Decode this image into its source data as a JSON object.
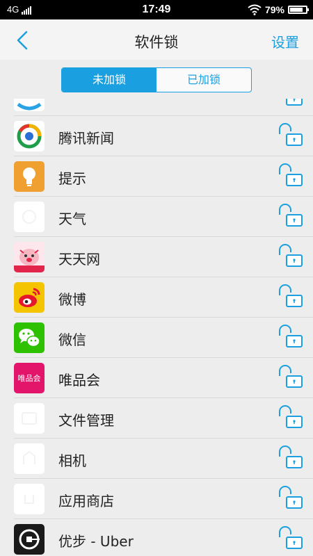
{
  "status": {
    "network": "4G",
    "time": "17:49",
    "battery": "79%"
  },
  "header": {
    "title": "软件锁",
    "settings_label": "设置"
  },
  "tabs": [
    {
      "label": "未加锁",
      "active": true
    },
    {
      "label": "已加锁",
      "active": false
    }
  ],
  "apps": [
    {
      "name": "",
      "icon": "partial-app-icon"
    },
    {
      "name": "腾讯新闻",
      "icon": "tencent-news-icon"
    },
    {
      "name": "提示",
      "icon": "tips-icon"
    },
    {
      "name": "天气",
      "icon": "weather-icon"
    },
    {
      "name": "天天网",
      "icon": "tiantian-icon"
    },
    {
      "name": "微博",
      "icon": "weibo-icon"
    },
    {
      "name": "微信",
      "icon": "wechat-icon"
    },
    {
      "name": "唯品会",
      "icon": "vipshop-icon",
      "icon_text": "唯品会"
    },
    {
      "name": "文件管理",
      "icon": "file-manager-icon"
    },
    {
      "name": "相机",
      "icon": "camera-icon"
    },
    {
      "name": "应用商店",
      "icon": "app-store-icon"
    },
    {
      "name": "优步 - Uber",
      "icon": "uber-icon"
    }
  ],
  "colors": {
    "accent": "#1aa0e0",
    "background": "#ededed",
    "weibo": "#f5c400",
    "wechat": "#2dc100",
    "vipshop": "#e2156b",
    "tips": "#f0a030",
    "uber": "#1a1a1a"
  }
}
